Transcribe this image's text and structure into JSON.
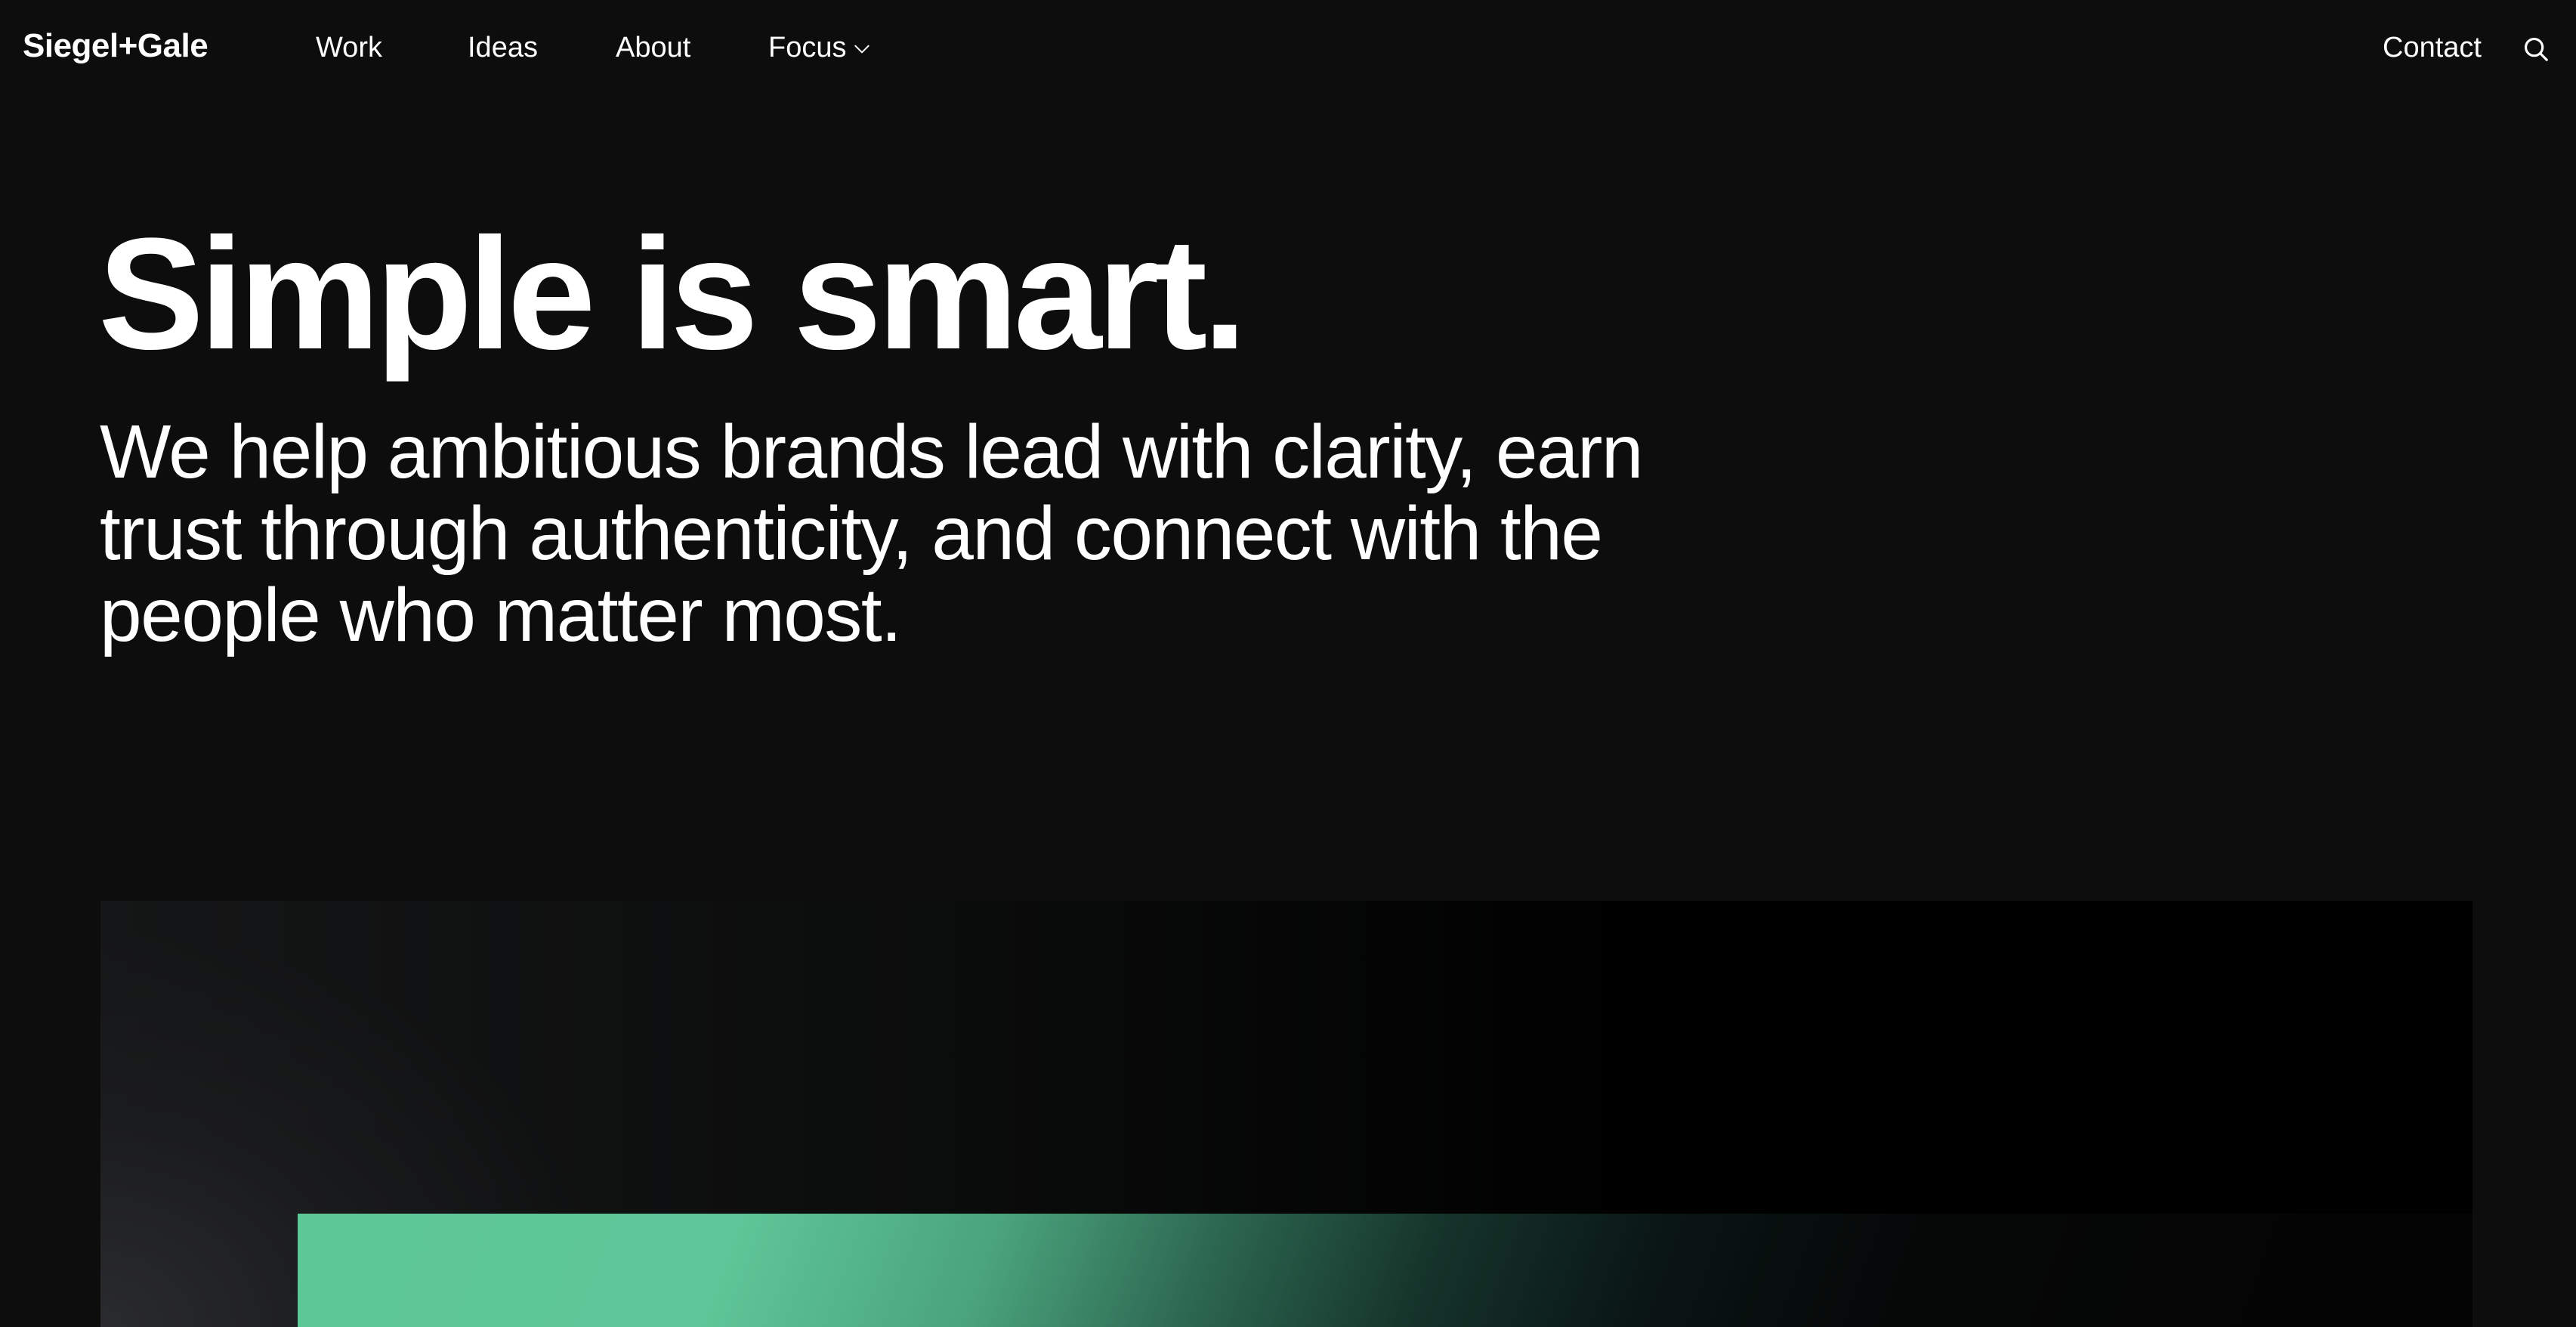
{
  "header": {
    "logo": "Siegel+Gale",
    "nav": {
      "work": "Work",
      "ideas": "Ideas",
      "about": "About",
      "focus": "Focus"
    },
    "contact": "Contact",
    "icons": {
      "focus_dropdown": "chevron-down-icon",
      "search": "search-icon"
    }
  },
  "hero": {
    "headline": "Simple is smart.",
    "subhead": "We help ambitious brands lead with clarity, earn trust through authenticity, and connect with the people who matter most."
  },
  "colors": {
    "background": "#0d0d0d",
    "text": "#ffffff",
    "accent_green": "#5fc899"
  }
}
